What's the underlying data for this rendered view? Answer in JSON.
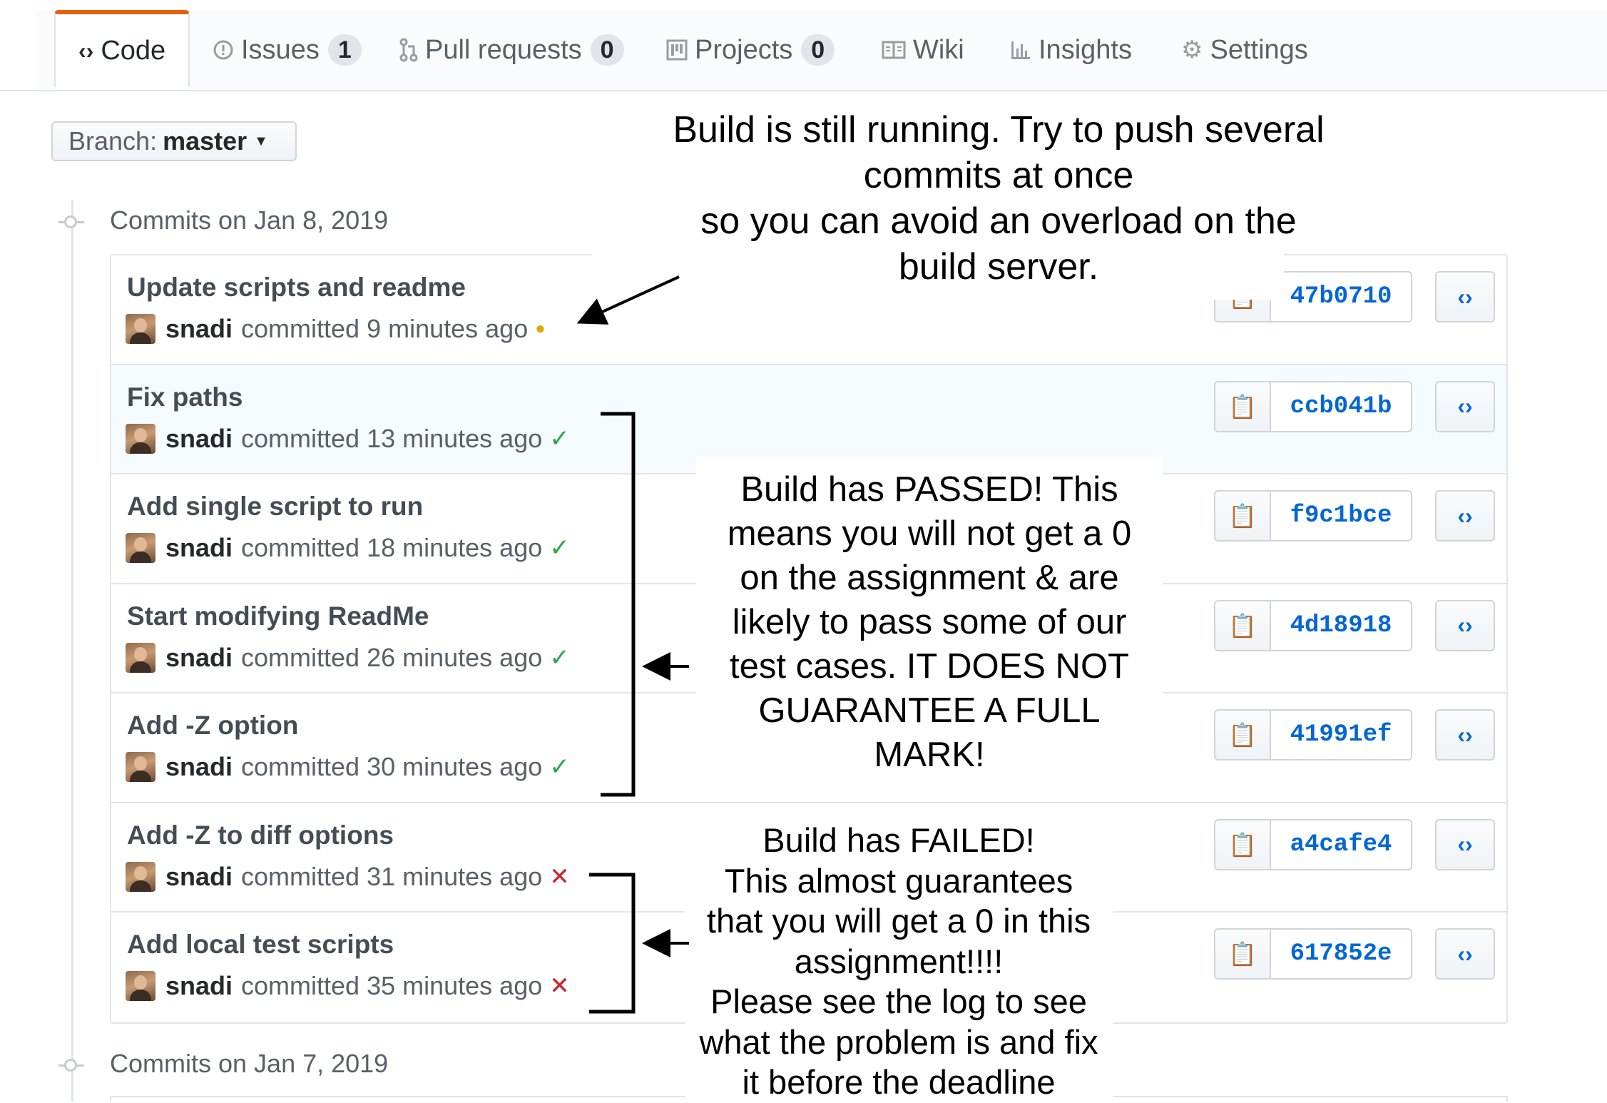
{
  "tabs": [
    {
      "label": "Code",
      "icon": "code-icon",
      "selected": true
    },
    {
      "label": "Issues",
      "icon": "issue-icon",
      "count": "1"
    },
    {
      "label": "Pull requests",
      "icon": "pull-request-icon",
      "count": "0"
    },
    {
      "label": "Projects",
      "icon": "project-icon",
      "count": "0"
    },
    {
      "label": "Wiki",
      "icon": "book-icon"
    },
    {
      "label": "Insights",
      "icon": "graph-icon"
    },
    {
      "label": "Settings",
      "icon": "gear-icon"
    }
  ],
  "branch": {
    "label": "Branch:",
    "value": "master"
  },
  "commit_groups": [
    {
      "date_label": "Commits on Jan 8, 2019"
    },
    {
      "date_label": "Commits on Jan 7, 2019"
    }
  ],
  "commits": [
    {
      "title": "Update scripts and readme",
      "author": "snadi",
      "time": "committed 9 minutes ago",
      "status": "pending",
      "status_glyph": "●",
      "sha": "47b0710"
    },
    {
      "title": "Fix paths",
      "author": "snadi",
      "time": "committed 13 minutes ago",
      "status": "success",
      "status_glyph": "✓",
      "sha": "ccb041b"
    },
    {
      "title": "Add single script to run",
      "author": "snadi",
      "time": "committed 18 minutes ago",
      "status": "success",
      "status_glyph": "✓",
      "sha": "f9c1bce"
    },
    {
      "title": "Start modifying ReadMe",
      "author": "snadi",
      "time": "committed 26 minutes ago",
      "status": "success",
      "status_glyph": "✓",
      "sha": "4d18918"
    },
    {
      "title": "Add -Z option",
      "author": "snadi",
      "time": "committed 30 minutes ago",
      "status": "success",
      "status_glyph": "✓",
      "sha": "41991ef"
    },
    {
      "title": "Add -Z to diff options",
      "author": "snadi",
      "time": "committed 31 minutes ago",
      "status": "failure",
      "status_glyph": "✕",
      "sha": "a4cafe4"
    },
    {
      "title": "Add local test scripts",
      "author": "snadi",
      "time": "committed 35 minutes ago",
      "status": "failure",
      "status_glyph": "✕",
      "sha": "617852e"
    }
  ],
  "icons": {
    "copy": "clipboard-icon",
    "browse": "code-browse-icon"
  },
  "annotations": {
    "running": "Build is still running. Try to push several\ncommits at once\nso you can avoid an overload on the\nbuild server.",
    "passed": "Build has PASSED! This\nmeans you will not get a 0\non the assignment & are\nlikely to pass some of our\ntest cases. IT DOES NOT\nGUARANTEE A FULL\nMARK!",
    "failed": "Build has FAILED!\nThis almost guarantees\nthat you will get a 0 in this\nassignment!!!!\nPlease see the log to see\nwhat the problem is and fix\nit before the deadline"
  },
  "colors": {
    "accent_tab": "#e36209",
    "link": "#0366d6",
    "pending": "#dbab09",
    "success": "#28a745",
    "failure": "#cb2431"
  }
}
